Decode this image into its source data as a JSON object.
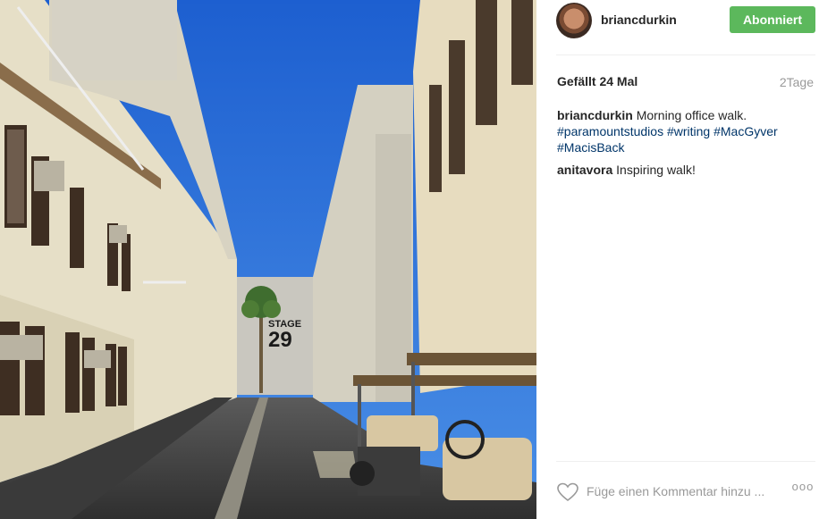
{
  "post": {
    "username": "briancdurkin",
    "follow_label": "Abonniert",
    "likes_text": "Gefällt 24 Mal",
    "time_ago": "2Tage",
    "caption": {
      "username": "briancdurkin",
      "text": "Morning office walk.",
      "hashtags": [
        "#paramountstudios",
        "#writing",
        "#MacGyver",
        "#MacisBack"
      ]
    },
    "comments": [
      {
        "username": "anitavora",
        "text": "Inspiring walk!"
      }
    ],
    "comment_placeholder": "Füge einen Kommentar hinzu ...",
    "more_label": "ooo"
  },
  "photo": {
    "stage_word": "STAGE",
    "stage_number": "29"
  },
  "colors": {
    "follow_button": "#5cb85c",
    "hashtag": "#003569",
    "sky": "#2a6fd6"
  },
  "icons": {
    "like": "heart-icon",
    "more": "more-options-icon"
  }
}
